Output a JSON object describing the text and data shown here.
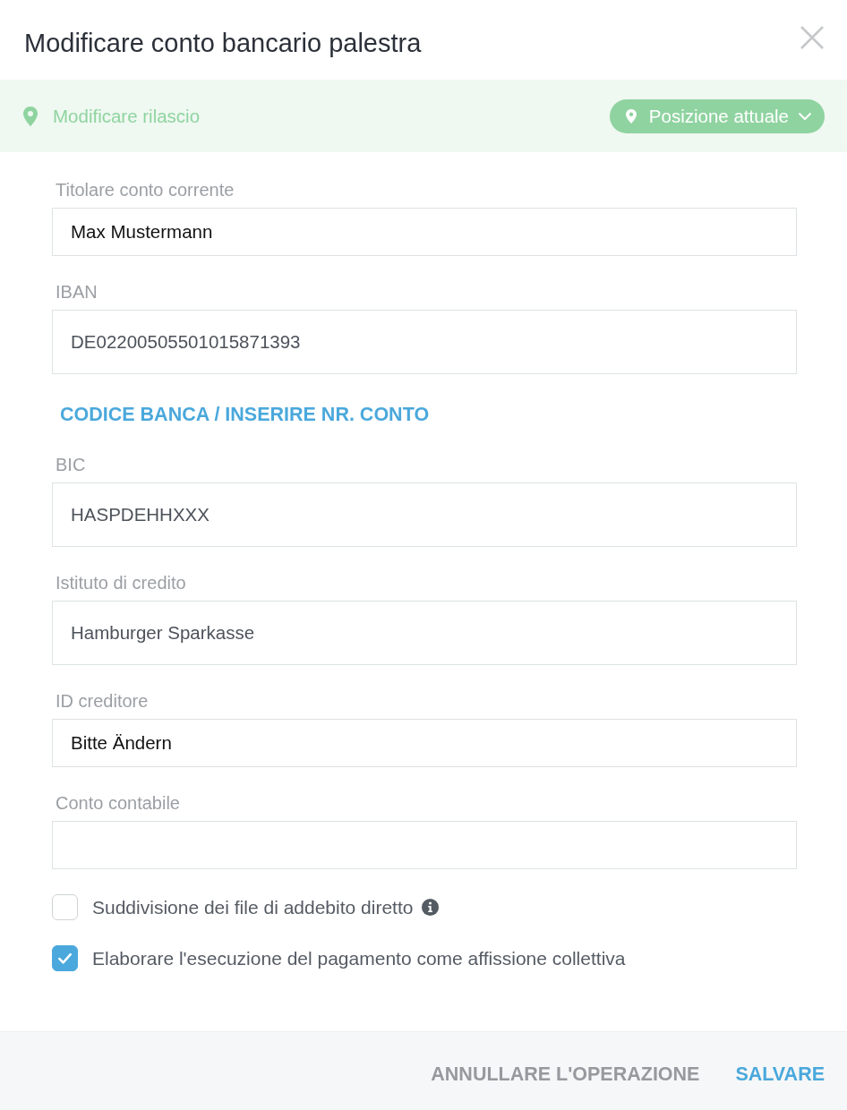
{
  "dialog": {
    "title": "Modificare conto bancario palestra"
  },
  "location_bar": {
    "label": "Modificare rilascio",
    "button": "Posizione attuale"
  },
  "form": {
    "items": [
      {
        "kind": "input",
        "label": "Titolare conto corrente",
        "value": "Max Mustermann"
      },
      {
        "kind": "box",
        "label": "IBAN",
        "value": "DE02200505501015871393"
      },
      {
        "kind": "link",
        "label": "CODICE BANCA / INSERIRE NR. CONTO"
      },
      {
        "kind": "box",
        "label": "BIC",
        "value": "HASPDEHHXXX"
      },
      {
        "kind": "box",
        "label": "Istituto di credito",
        "value": "Hamburger Sparkasse"
      },
      {
        "kind": "input",
        "label": "ID creditore",
        "value": "Bitte Ändern"
      },
      {
        "kind": "input",
        "label": "Conto contabile"
      }
    ]
  },
  "checkboxes": [
    {
      "label": "Suddivisione dei file di addebito diretto",
      "checked": false,
      "info": true
    },
    {
      "label": "Elaborare l'esecuzione del pagamento come affissione collettiva",
      "checked": true,
      "info": false
    }
  ],
  "footer": {
    "buttons": [
      {
        "label": "ANNULLARE L'OPERAZIONE",
        "kind": "secondary"
      },
      {
        "label": "SALVARE",
        "kind": "primary"
      }
    ]
  }
}
